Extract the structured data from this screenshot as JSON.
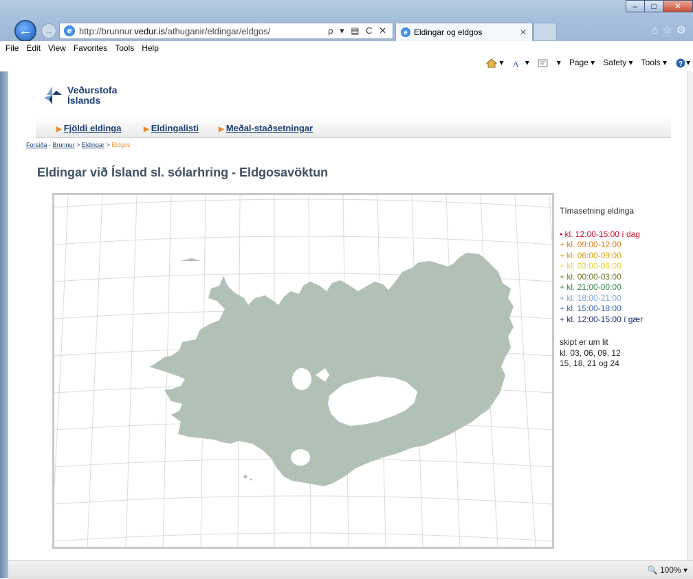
{
  "browser": {
    "address": {
      "prefix": "http://brunnur.",
      "domain": "vedur.is",
      "path": "/athuganir/eldingar/eldgos/"
    },
    "address_tools": "ρ ▾ ▤ C ✕",
    "tab_title": "Eldingar og eldgos",
    "menu": [
      "File",
      "Edit",
      "View",
      "Favorites",
      "Tools",
      "Help"
    ],
    "commands": {
      "page": "Page ▾",
      "safety": "Safety ▾",
      "tools": "Tools ▾"
    },
    "zoom": "100%"
  },
  "site": {
    "logo_line1": "Veðurstofa",
    "logo_line2": "Íslands",
    "nav": [
      "Fjöldi eldinga",
      "Eldingalisti",
      "Meðal-staðsetningar"
    ],
    "breadcrumb": {
      "home": "Forsíða",
      "sep1": " - ",
      "brunnur": "Brunnur",
      "sep2": " > ",
      "eldingar": "Eldingar",
      "sep3": " > ",
      "current": "Eldgos"
    },
    "title": "Eldingar við Ísland sl. sólarhring - Eldgosavöktun"
  },
  "legend": {
    "heading": "Tímasetning eldinga",
    "items": [
      {
        "marker": "•",
        "label": "kl. 12:00-15:00 í dag",
        "color": "#c8102e"
      },
      {
        "marker": "+",
        "label": "kl. 09:00-12:00",
        "color": "#e07b14"
      },
      {
        "marker": "+",
        "label": "kl. 06:00-09:00",
        "color": "#d4a10a"
      },
      {
        "marker": "+",
        "label": "kl. 03:00-06:00",
        "color": "#e2d23a"
      },
      {
        "marker": "+",
        "label": "kl. 00:00-03:00",
        "color": "#6b7a20"
      },
      {
        "marker": "+",
        "label": "kl. 21:00-00:00",
        "color": "#2f8a4a"
      },
      {
        "marker": "+",
        "label": "kl. 18:00-21:00",
        "color": "#7fa7d6"
      },
      {
        "marker": "+",
        "label": "kl. 15:00-18:00",
        "color": "#2f5fae"
      },
      {
        "marker": "+",
        "label": "kl. 12:00-15:00 í gær",
        "color": "#1b2c6a"
      }
    ],
    "note_lines": [
      "skipt er um lit",
      "kl. 03, 06, 09, 12",
      "15, 18, 21 og 24"
    ]
  },
  "colors": {
    "land": "#b2c1b6",
    "grid": "#dadada",
    "accent": "#e88822",
    "brand": "#1b3e74"
  }
}
